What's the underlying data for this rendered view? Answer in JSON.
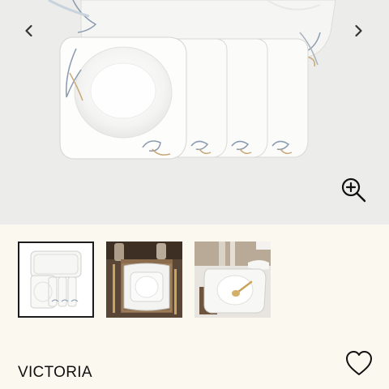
{
  "gallery": {
    "image": "square-rim-soup-plates-stack",
    "prev_icon": "chevron-left-icon",
    "next_icon": "chevron-right-icon",
    "zoom_icon": "zoom-in-icon"
  },
  "thumbnails": [
    {
      "image": "plate-set-overview",
      "selected": true
    },
    {
      "image": "table-setting-square-plates",
      "selected": false
    },
    {
      "image": "table-setting-soup-plate-with-spoon",
      "selected": false
    }
  ],
  "product": {
    "title": "VICTORIA",
    "favorite_icon": "heart-outline-icon"
  },
  "colors": {
    "page_background": "#fbf8ef",
    "gallery_background": "#ececea",
    "selected_border": "#1c1c1c"
  }
}
